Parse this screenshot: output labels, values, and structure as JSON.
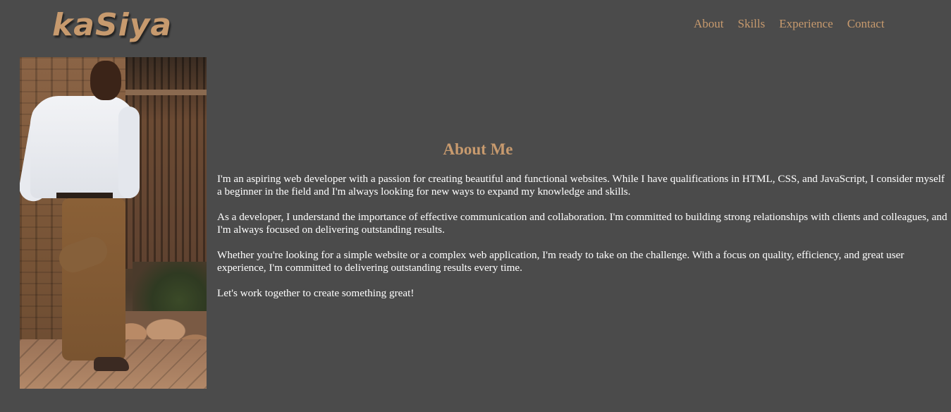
{
  "logo": {
    "text": "kaSiya"
  },
  "nav": {
    "items": [
      {
        "label": "About"
      },
      {
        "label": "Skills"
      },
      {
        "label": "Experience"
      },
      {
        "label": "Contact"
      }
    ]
  },
  "profile": {
    "photo_alt": "Portrait photo"
  },
  "about": {
    "title": "About Me",
    "paragraphs": [
      "I'm an aspiring web developer with a passion for creating beautiful and functional websites. While I have qualifications in HTML, CSS, and JavaScript, I consider myself a beginner in the field and I'm always looking for new ways to expand my knowledge and skills.",
      "As a developer, I understand the importance of effective communication and collaboration. I'm committed to building strong relationships with clients and colleagues, and I'm always focused on delivering outstanding results.",
      "Whether you're looking for a simple website or a complex web application, I'm ready to take on the challenge. With a focus on quality, efficiency, and great user experience, I'm committed to delivering outstanding results every time.",
      "Let's work together to create something great!"
    ]
  },
  "colors": {
    "background": "#4b4b4b",
    "accent": "#c79a6e",
    "body_text": "#ffffff"
  }
}
